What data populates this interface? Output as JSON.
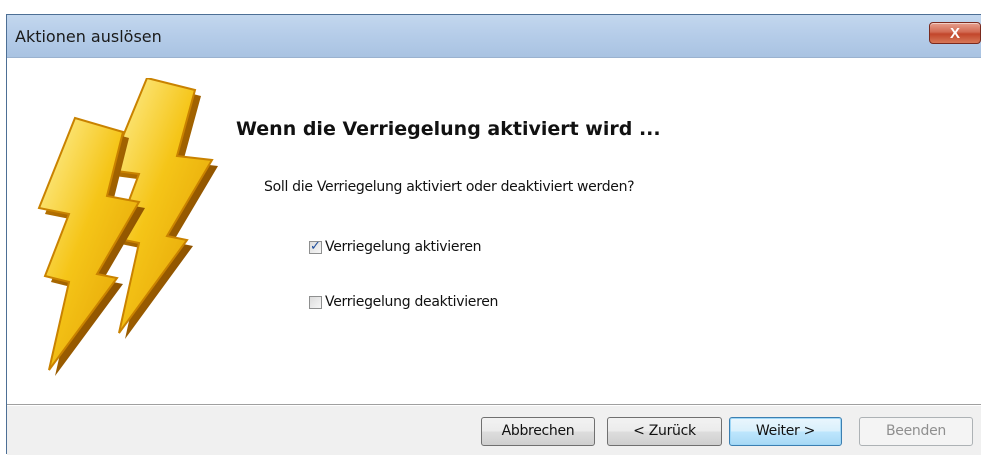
{
  "window": {
    "title": "Aktionen auslösen",
    "close_label": "X"
  },
  "content": {
    "heading": "Wenn die Verriegelung aktiviert wird ...",
    "question": "Soll die Verriegelung aktiviert oder deaktiviert werden?",
    "options": [
      {
        "label": "Verriegelung aktivieren",
        "checked": true
      },
      {
        "label": "Verriegelung deaktivieren",
        "checked": false
      }
    ],
    "illustration": "lightning-bolts-icon"
  },
  "footer": {
    "cancel": "Abbrechen",
    "back": "< Zurück",
    "next": "Weiter >",
    "finish": "Beenden"
  },
  "colors": {
    "titlebar": "#b6cde9",
    "close_button": "#c2462b",
    "default_button": "#bee6fd",
    "footer_bg": "#f0f0f0",
    "bolt_yellow": "#f5c518",
    "bolt_orange": "#d98a00"
  }
}
